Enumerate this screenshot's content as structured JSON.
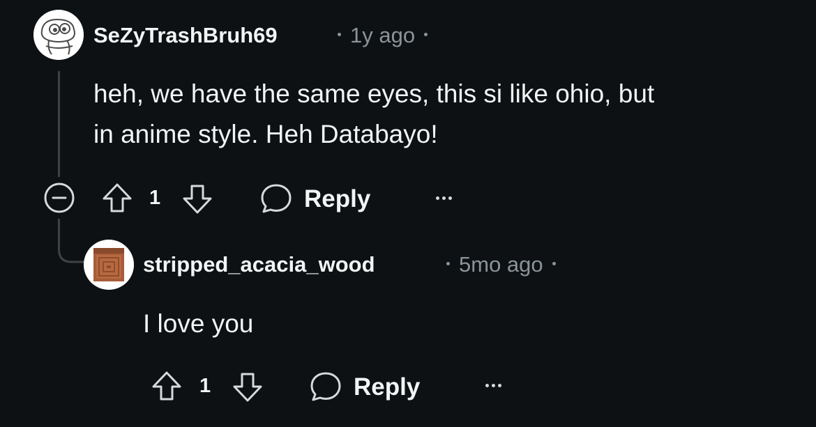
{
  "comments": [
    {
      "username": "SeZyTrashBruh69",
      "age": "1y ago",
      "avatar_icon": "snoo-avatar-icon",
      "text_lines": [
        "heh, we have the same eyes, this si like ohio, but",
        "in anime style. Heh Databayo!"
      ],
      "votes": "1",
      "reply_label": "Reply",
      "collapse_icon": "collapse-minus-icon"
    },
    {
      "username": "stripped_acacia_wood",
      "age": "5mo ago",
      "avatar_icon": "acacia-wood-block-icon",
      "text_lines": [
        "I love you"
      ],
      "votes": "1",
      "reply_label": "Reply"
    }
  ],
  "colors": {
    "background": "#0e1113",
    "text": "#f2f4f5",
    "meta": "#8a9499",
    "thread_line": "#3e4245"
  }
}
